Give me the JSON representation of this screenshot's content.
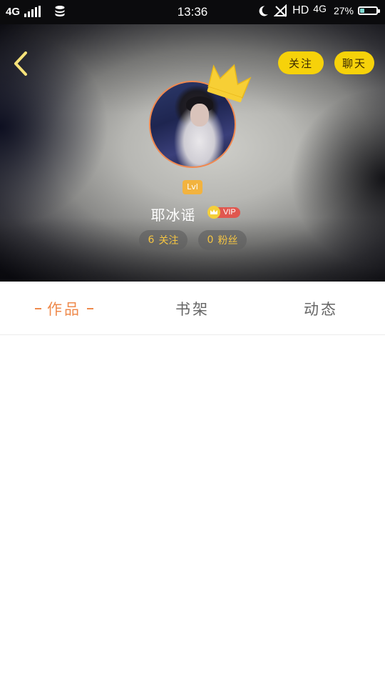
{
  "status_bar": {
    "network": "4G",
    "time": "13:36",
    "hd": "HD",
    "network_right": "4G",
    "battery_percent": "27%",
    "battery_level": 0.27,
    "icons": [
      "signal-icon",
      "data-icon",
      "moon-icon",
      "no-signal-icon",
      "battery-icon"
    ]
  },
  "header": {
    "follow_label": "关注",
    "chat_label": "聊天",
    "level": "Lvl",
    "username": "耶冰谣",
    "vip_label": "VIP",
    "following": {
      "count": "6",
      "label": "关注"
    },
    "fans": {
      "count": "0",
      "label": "粉丝"
    },
    "colors": {
      "accent_yellow": "#f6d20a",
      "avatar_border": "#f0884f",
      "stat_text": "#f5c542",
      "vip_red": "#e0574f"
    }
  },
  "tabs": [
    {
      "label": "作品",
      "active": true
    },
    {
      "label": "书架",
      "active": false
    },
    {
      "label": "动态",
      "active": false
    }
  ],
  "theme": {
    "active_tab_color": "#ef8a4c"
  }
}
